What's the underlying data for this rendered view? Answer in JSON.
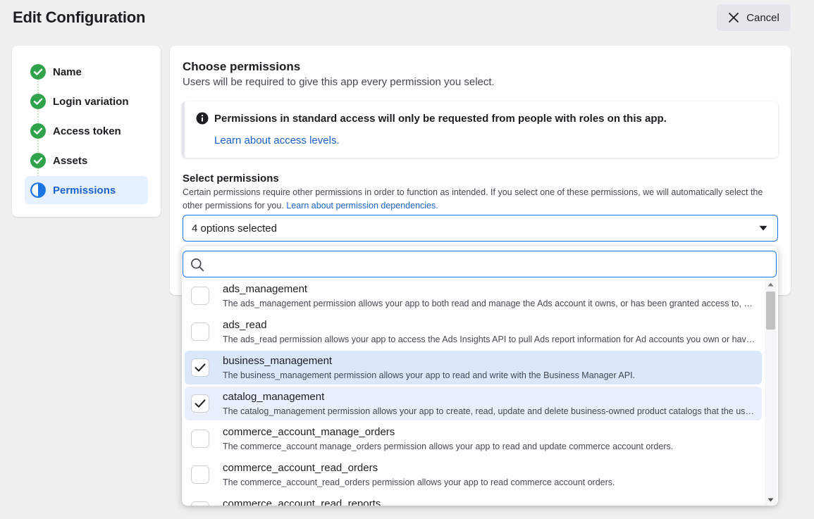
{
  "header": {
    "title": "Edit Configuration",
    "cancel_label": "Cancel"
  },
  "stepper": {
    "steps": [
      {
        "label": "Name",
        "status": "complete"
      },
      {
        "label": "Login variation",
        "status": "complete"
      },
      {
        "label": "Access token",
        "status": "complete"
      },
      {
        "label": "Assets",
        "status": "complete"
      },
      {
        "label": "Permissions",
        "status": "in-progress"
      }
    ]
  },
  "permissions": {
    "title": "Choose permissions",
    "subtitle": "Users will be required to give this app every permission you select.",
    "info_banner": {
      "text": "Permissions in standard access will only be requested from people with roles on this app.",
      "link": "Learn about access levels."
    },
    "select_label": "Select permissions",
    "select_description": "Certain permissions require other permissions in order to function as intended. If you select one of these permissions, we will automatically select the other permissions for you.",
    "select_description_link": "Learn about permission dependencies.",
    "select_value": "4 options selected",
    "search_placeholder": "",
    "options": [
      {
        "name": "ads_management",
        "description": "The ads_management permission allows your app to both read and manage the Ads account it owns, or has been granted access to, by the Ad account owner.",
        "checked": false
      },
      {
        "name": "ads_read",
        "description": "The ads_read permission allows your app to access the Ads Insights API to pull Ads report information for Ad accounts you own or have been granted access to.",
        "checked": false
      },
      {
        "name": "business_management",
        "description": "The business_management permission allows your app to read and write with the Business Manager API.",
        "checked": true
      },
      {
        "name": "catalog_management",
        "description": "The catalog_management permission allows your app to create, read, update and delete business-owned product catalogs that the user is an admin of.",
        "checked": true
      },
      {
        "name": "commerce_account_manage_orders",
        "description": "The commerce_account manage_orders permission allows your app to read and update commerce account orders.",
        "checked": false
      },
      {
        "name": "commerce_account_read_orders",
        "description": "The commerce_account_read_orders permission allows your app to read commerce account orders.",
        "checked": false
      },
      {
        "name": "commerce_account_read_reports",
        "description": "",
        "checked": false
      }
    ]
  },
  "colors": {
    "accent": "#1b74e4",
    "complete_green": "#31a24c",
    "selected_row": "#dbe7fb"
  }
}
